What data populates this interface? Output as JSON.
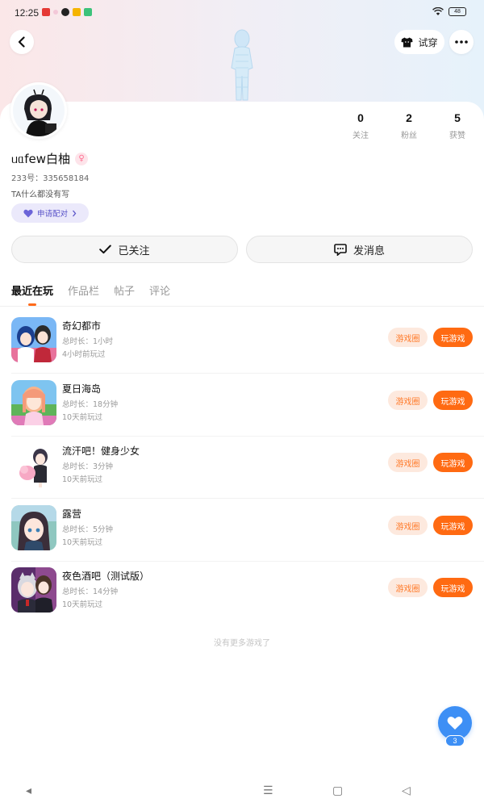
{
  "status_bar": {
    "time": "12:25",
    "battery": "48"
  },
  "header": {
    "try_on_label": "试穿"
  },
  "profile": {
    "username": "ᥙᥲfew白柚",
    "uid": "233号：335658184",
    "bio": "TA什么都没有写",
    "pair_label": "申请配对",
    "stats": [
      {
        "value": "0",
        "label": "关注"
      },
      {
        "value": "2",
        "label": "粉丝"
      },
      {
        "value": "5",
        "label": "获赞"
      }
    ]
  },
  "actions": {
    "follow_label": "已关注",
    "message_label": "发消息"
  },
  "tabs": [
    {
      "label": "最近在玩",
      "active": true
    },
    {
      "label": "作品栏",
      "active": false
    },
    {
      "label": "帖子",
      "active": false
    },
    {
      "label": "评论",
      "active": false
    }
  ],
  "games": [
    {
      "title": "奇幻都市",
      "duration": "总时长：1小时",
      "last_played": "4小时前玩过",
      "circle_label": "游戏圈",
      "play_label": "玩游戏"
    },
    {
      "title": "夏日海岛",
      "duration": "总时长：18分钟",
      "last_played": "10天前玩过",
      "circle_label": "游戏圈",
      "play_label": "玩游戏"
    },
    {
      "title": "流汗吧！健身少女",
      "duration": "总时长：3分钟",
      "last_played": "10天前玩过",
      "circle_label": "游戏圈",
      "play_label": "玩游戏"
    },
    {
      "title": "露营",
      "duration": "总时长：5分钟",
      "last_played": "10天前玩过",
      "circle_label": "游戏圈",
      "play_label": "玩游戏"
    },
    {
      "title": "夜色酒吧（测试版）",
      "duration": "总时长：14分钟",
      "last_played": "10天前玩过",
      "circle_label": "游戏圈",
      "play_label": "玩游戏"
    }
  ],
  "no_more_text": "没有更多游戏了",
  "fab": {
    "badge": "3"
  },
  "colors": {
    "accent": "#ff6a12",
    "accent_soft": "#fde9de",
    "fab": "#3d8ff5",
    "pair": "#5b55c9"
  }
}
